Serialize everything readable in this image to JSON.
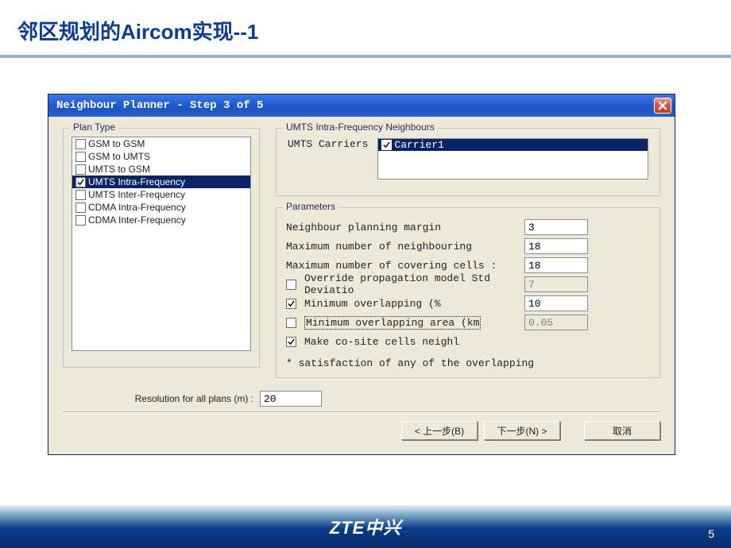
{
  "slide": {
    "title": "邻区规划的Aircom实现--1",
    "page_number": "5",
    "footer_brand": "ZTE中兴"
  },
  "window": {
    "title": "Neighbour Planner - Step 3 of 5",
    "plan_type": {
      "legend": "Plan Type",
      "items": [
        {
          "label": "GSM to GSM",
          "checked": false,
          "selected": false
        },
        {
          "label": "GSM to UMTS",
          "checked": false,
          "selected": false
        },
        {
          "label": "UMTS to GSM",
          "checked": false,
          "selected": false
        },
        {
          "label": "UMTS Intra-Frequency",
          "checked": true,
          "selected": true
        },
        {
          "label": "UMTS Inter-Frequency",
          "checked": false,
          "selected": false
        },
        {
          "label": "CDMA Intra-Frequency",
          "checked": false,
          "selected": false
        },
        {
          "label": "CDMA Inter-Frequency",
          "checked": false,
          "selected": false
        }
      ]
    },
    "umts_neighbours": {
      "legend": "UMTS Intra-Frequency Neighbours",
      "carriers_label": "UMTS Carriers",
      "carriers": [
        {
          "label": "Carrier1",
          "checked": true,
          "selected": true
        }
      ]
    },
    "parameters": {
      "legend": "Parameters",
      "rows": {
        "margin": {
          "label": "Neighbour planning margin",
          "value": "3"
        },
        "max_neighbour": {
          "label": "Maximum number of neighbouring",
          "value": "18"
        },
        "max_covering": {
          "label": "Maximum number of covering cells :",
          "value": "18"
        },
        "override_std": {
          "label": "Override propagation model Std Deviatio",
          "checked": false,
          "value": "7",
          "disabled": true
        },
        "min_overlap_pct": {
          "label": "Minimum overlapping (%",
          "checked": true,
          "value": "10"
        },
        "min_overlap_area": {
          "label": "Minimum overlapping area (km",
          "checked": false,
          "value": "0.05",
          "disabled": true,
          "dotted": true
        },
        "cosite": {
          "label": "Make co-site cells neighl",
          "checked": true
        }
      },
      "note": "* satisfaction of any of the overlapping"
    },
    "resolution": {
      "label": "Resolution for all plans (m) :",
      "value": "20"
    },
    "buttons": {
      "back": "< 上一步(B)",
      "next": "下一步(N) >",
      "cancel": "取消"
    }
  }
}
